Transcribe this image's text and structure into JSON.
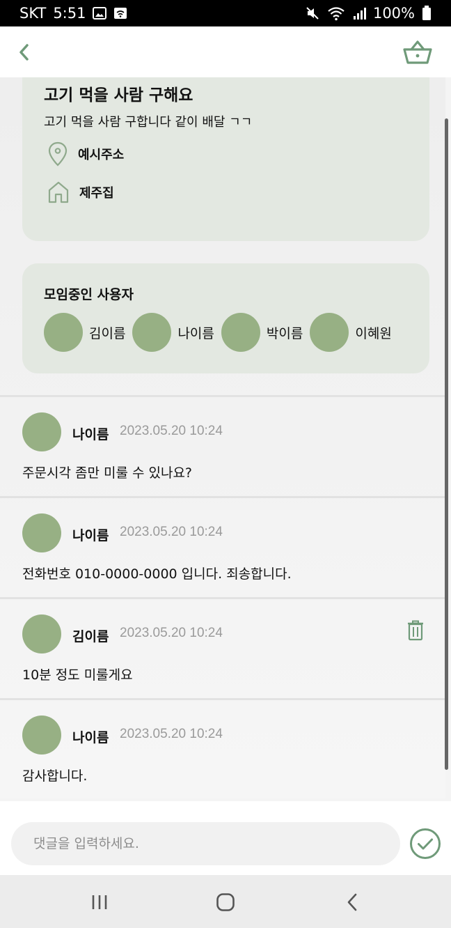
{
  "status_bar": {
    "carrier": "SKT",
    "time": "5:51",
    "battery": "100%"
  },
  "header": {
    "back_icon": "chevron-left-icon",
    "basket_icon": "basket-icon"
  },
  "post": {
    "title": "고기 먹을 사람 구해요",
    "body": "고기 먹을 사람 구합니다 같이 배달 ㄱㄱ",
    "address": "예시주소",
    "place": "제주집"
  },
  "members": {
    "title": "모임중인 사용자",
    "items": [
      {
        "name": "김이름"
      },
      {
        "name": "나이름"
      },
      {
        "name": "박이름"
      },
      {
        "name": "이혜원"
      }
    ]
  },
  "comments": [
    {
      "author": "나이름",
      "time": "2023.05.20 10:24",
      "text": "주문시각 좀만 미룰 수 있나요?",
      "deletable": false
    },
    {
      "author": "나이름",
      "time": "2023.05.20 10:24",
      "text": "전화번호 010-0000-0000 입니다. 죄송합니다.",
      "deletable": false
    },
    {
      "author": "김이름",
      "time": "2023.05.20 10:24",
      "text": "10분 정도 미룰게요",
      "deletable": true
    },
    {
      "author": "나이름",
      "time": "2023.05.20 10:24",
      "text": "감사합니다.",
      "deletable": false
    }
  ],
  "comment_input": {
    "placeholder": "댓글을 입력하세요.",
    "value": ""
  },
  "colors": {
    "accent": "#6f9a79",
    "card": "#e3e8e1",
    "avatar": "#97b084"
  }
}
